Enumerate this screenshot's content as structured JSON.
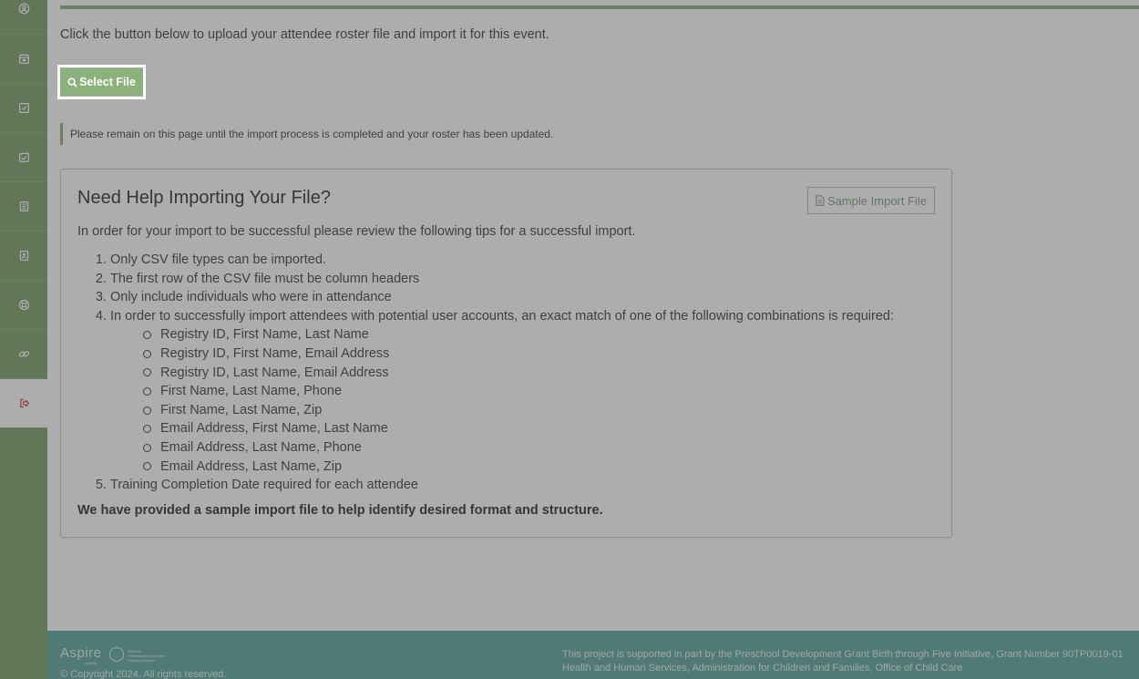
{
  "sidebar": {
    "items": [
      {
        "icon": "user-circle-icon"
      },
      {
        "icon": "calendar-icon"
      },
      {
        "icon": "checkbox-icon"
      },
      {
        "icon": "calendar-check-icon"
      },
      {
        "icon": "book-icon"
      },
      {
        "icon": "contact-card-icon"
      },
      {
        "icon": "support-icon"
      },
      {
        "icon": "link-icon"
      },
      {
        "icon": "sign-out-icon",
        "active": true
      }
    ]
  },
  "main": {
    "intro": "Click the button below to upload your attendee roster file and import it for this event.",
    "select_button_label": "Select File",
    "notice": "Please remain on this page until the import process is completed and your roster has been updated."
  },
  "help": {
    "title": "Need Help Importing Your File?",
    "sample_button_label": "Sample Import File",
    "description": "In order for your import to be successful please review the following tips for a successful import.",
    "tips": [
      "Only CSV file types can be imported.",
      "The first row of the CSV file must be column headers",
      "Only include individuals who were in attendance",
      "In order to successfully import attendees with potential user accounts, an exact match of one of the following combinations is required:",
      "Training Completion Date required for each attendee"
    ],
    "tip_numbers": [
      "1.",
      "2.",
      "3.",
      "4.",
      "5."
    ],
    "combinations": [
      "Registry ID, First Name, Last Name",
      "Registry ID, First Name, Email Address",
      "Registry ID, Last Name, Email Address",
      "First Name, Last Name, Phone",
      "First Name, Last Name, Zip",
      "Email Address, First Name, Last Name",
      "Email Address, Last Name, Phone",
      "Email Address, Last Name, Zip"
    ],
    "footer_note": "We have provided a sample import file to help identify desired format and structure."
  },
  "footer": {
    "logo_text": "Aspire",
    "logo_sub": "registry",
    "partner_logo_text": [
      "National",
      "Professional Workforce",
      "Registry Alliance"
    ],
    "copyright": "© Copyright 2024. All rights reserved.",
    "support_line1": "This project is supported in part by the Preschool Development Grant Birth through Five Initiative, Grant Number 90TP0019-01",
    "support_line2": "Health and Human Services, Administration for Children and Families, Office of Child Care"
  },
  "colors": {
    "sidebar": "#7ca36d",
    "accent": "#8cb27c",
    "footer": "#5fa8a0",
    "overlay": "rgba(60,60,60,0.42)"
  }
}
